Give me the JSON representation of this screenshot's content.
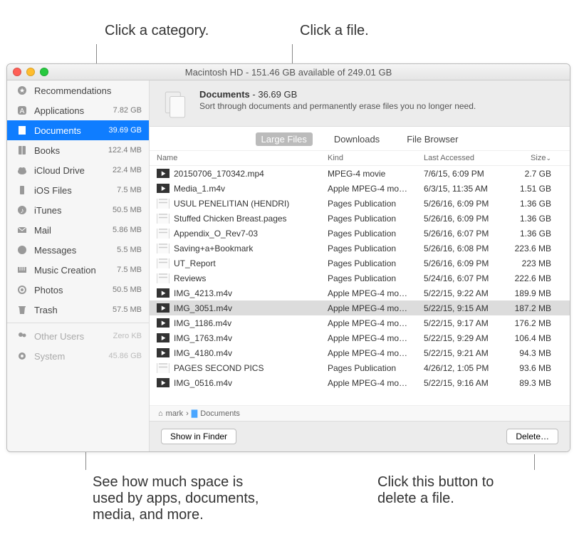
{
  "callouts": {
    "top_left": "Click a category.",
    "top_right": "Click a file.",
    "bottom_left": "See how much space is used by apps, documents, media, and more.",
    "bottom_right": "Click this button to delete a file."
  },
  "window": {
    "title": "Macintosh HD - 151.46 GB available of 249.01 GB"
  },
  "sidebar": {
    "items": [
      {
        "label": "Recommendations",
        "size": "",
        "icon": "star"
      },
      {
        "label": "Applications",
        "size": "7.82 GB",
        "icon": "app"
      },
      {
        "label": "Documents",
        "size": "39.69 GB",
        "icon": "doc",
        "selected": true
      },
      {
        "label": "Books",
        "size": "122.4 MB",
        "icon": "book"
      },
      {
        "label": "iCloud Drive",
        "size": "22.4 MB",
        "icon": "cloud"
      },
      {
        "label": "iOS Files",
        "size": "7.5 MB",
        "icon": "phone"
      },
      {
        "label": "iTunes",
        "size": "50.5 MB",
        "icon": "music"
      },
      {
        "label": "Mail",
        "size": "5.86 MB",
        "icon": "mail"
      },
      {
        "label": "Messages",
        "size": "5.5 MB",
        "icon": "chat"
      },
      {
        "label": "Music Creation",
        "size": "7.5 MB",
        "icon": "piano"
      },
      {
        "label": "Photos",
        "size": "50.5 MB",
        "icon": "photo"
      },
      {
        "label": "Trash",
        "size": "57.5 MB",
        "icon": "trash"
      }
    ],
    "disabled": [
      {
        "label": "Other Users",
        "size": "Zero KB",
        "icon": "users"
      },
      {
        "label": "System",
        "size": "45.86 GB",
        "icon": "gear"
      }
    ]
  },
  "header": {
    "title_bold": "Documents",
    "title_rest": " - 36.69 GB",
    "subtitle": "Sort through documents and permanently erase files you no longer need."
  },
  "tabs": [
    {
      "label": "Large Files",
      "active": true
    },
    {
      "label": "Downloads",
      "active": false
    },
    {
      "label": "File Browser",
      "active": false
    }
  ],
  "columns": {
    "name": "Name",
    "kind": "Kind",
    "date": "Last Accessed",
    "size": "Size"
  },
  "files": [
    {
      "name": "20150706_170342.mp4",
      "kind": "MPEG-4 movie",
      "date": "7/6/15, 6:09 PM",
      "size": "2.7 GB",
      "icon": "video"
    },
    {
      "name": "Media_1.m4v",
      "kind": "Apple MPEG-4 mo…",
      "date": "6/3/15, 11:35 AM",
      "size": "1.51 GB",
      "icon": "video"
    },
    {
      "name": "USUL PENELITIAN (HENDRI)",
      "kind": "Pages Publication",
      "date": "5/26/16, 6:09 PM",
      "size": "1.36 GB",
      "icon": "pages"
    },
    {
      "name": "Stuffed Chicken Breast.pages",
      "kind": "Pages Publication",
      "date": "5/26/16, 6:09 PM",
      "size": "1.36 GB",
      "icon": "pages"
    },
    {
      "name": "Appendix_O_Rev7-03",
      "kind": "Pages Publication",
      "date": "5/26/16, 6:07 PM",
      "size": "1.36 GB",
      "icon": "pages",
      "actions": true
    },
    {
      "name": "Saving+a+Bookmark",
      "kind": "Pages Publication",
      "date": "5/26/16, 6:08 PM",
      "size": "223.6 MB",
      "icon": "pages"
    },
    {
      "name": "UT_Report",
      "kind": "Pages Publication",
      "date": "5/26/16, 6:09 PM",
      "size": "223 MB",
      "icon": "pages"
    },
    {
      "name": "Reviews",
      "kind": "Pages Publication",
      "date": "5/24/16, 6:07 PM",
      "size": "222.6 MB",
      "icon": "pages"
    },
    {
      "name": "IMG_4213.m4v",
      "kind": "Apple MPEG-4 mo…",
      "date": "5/22/15, 9:22 AM",
      "size": "189.9 MB",
      "icon": "video"
    },
    {
      "name": "IMG_3051.m4v",
      "kind": "Apple MPEG-4 mo…",
      "date": "5/22/15, 9:15 AM",
      "size": "187.2 MB",
      "icon": "video",
      "selected": true
    },
    {
      "name": "IMG_1186.m4v",
      "kind": "Apple MPEG-4 mo…",
      "date": "5/22/15, 9:17 AM",
      "size": "176.2 MB",
      "icon": "video"
    },
    {
      "name": "IMG_1763.m4v",
      "kind": "Apple MPEG-4 mo…",
      "date": "5/22/15, 9:29 AM",
      "size": "106.4 MB",
      "icon": "video"
    },
    {
      "name": "IMG_4180.m4v",
      "kind": "Apple MPEG-4 mo…",
      "date": "5/22/15, 9:21 AM",
      "size": "94.3 MB",
      "icon": "video"
    },
    {
      "name": "PAGES SECOND PICS",
      "kind": "Pages Publication",
      "date": "4/26/12, 1:05 PM",
      "size": "93.6 MB",
      "icon": "pages"
    },
    {
      "name": "IMG_0516.m4v",
      "kind": "Apple MPEG-4 mo…",
      "date": "5/22/15, 9:16 AM",
      "size": "89.3 MB",
      "icon": "video"
    }
  ],
  "breadcrumb": {
    "user": "mark",
    "folder": "Documents",
    "sep": "›"
  },
  "footer": {
    "show": "Show in Finder",
    "delete": "Delete…"
  }
}
